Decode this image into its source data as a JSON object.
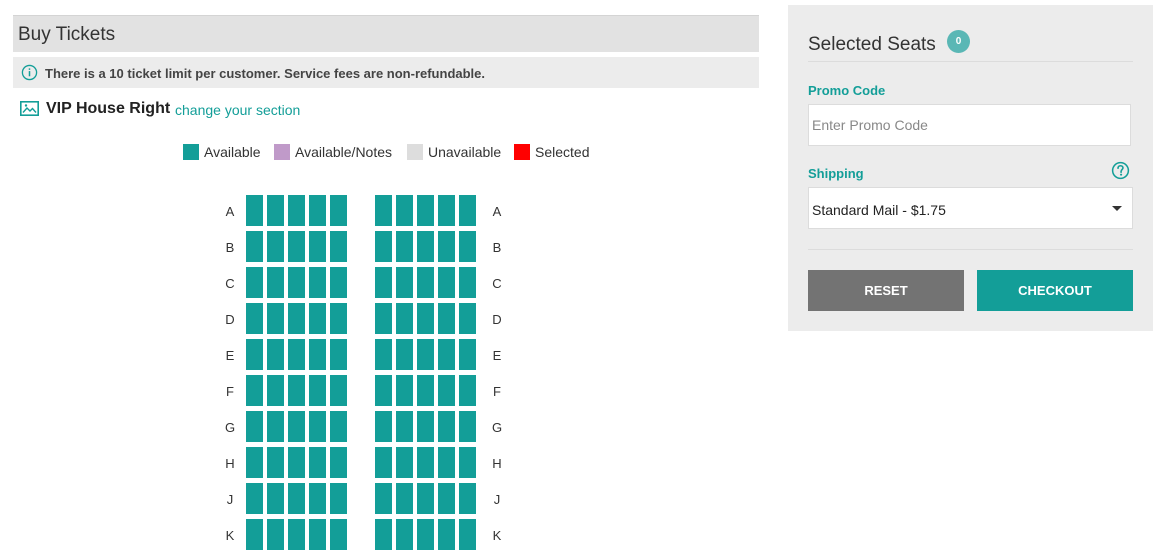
{
  "header": {
    "title": "Buy Tickets"
  },
  "notice": {
    "icon": "info-icon",
    "text": "There is a 10 ticket limit per customer. Service fees are non-refundable."
  },
  "section": {
    "icon": "image-icon",
    "name": "VIP House Right",
    "change_link": "change your section"
  },
  "legend": [
    {
      "label": "Available",
      "color": "#139e98"
    },
    {
      "label": "Available/Notes",
      "color": "#c09ac9"
    },
    {
      "label": "Unavailable",
      "color": "#dddddd"
    },
    {
      "label": "Selected",
      "color": "#ff0000"
    }
  ],
  "seat_map": {
    "rows": [
      "A",
      "B",
      "C",
      "D",
      "E",
      "F",
      "G",
      "H",
      "J",
      "K"
    ],
    "seats_per_block": 5,
    "blocks": 2,
    "seat_color": "#139e98"
  },
  "panel": {
    "title": "Selected Seats",
    "selected_count": "0",
    "promo": {
      "label": "Promo Code",
      "placeholder": "Enter Promo Code",
      "value": ""
    },
    "shipping": {
      "label": "Shipping",
      "selected": "Standard Mail - $1.75",
      "help_icon": "question-circle-icon"
    },
    "reset_label": "RESET",
    "checkout_label": "CHECKOUT"
  },
  "colors": {
    "accent": "#139e98",
    "reset_button": "#737373",
    "badge": "#5ab7b5"
  }
}
